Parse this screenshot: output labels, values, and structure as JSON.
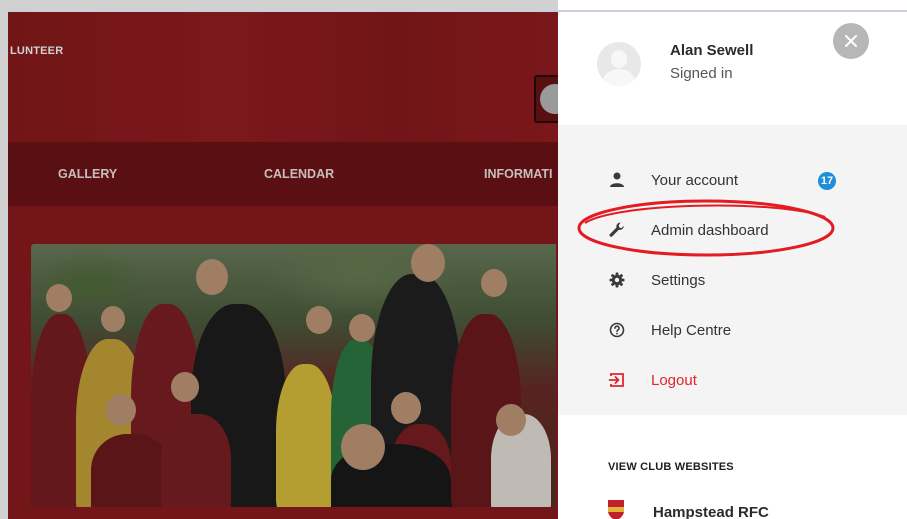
{
  "background_site": {
    "title": "LUNTEER",
    "nav": [
      {
        "label": "GALLERY"
      },
      {
        "label": "CALENDAR"
      },
      {
        "label": "INFORMATI"
      }
    ],
    "brand_color": "#8e1b1f"
  },
  "panel": {
    "user": {
      "name": "Alan Sewell",
      "status": "Signed in",
      "avatar_icon": "user-placeholder-icon"
    },
    "close_icon": "close-icon",
    "menu": [
      {
        "label": "Your account",
        "icon": "person-icon",
        "badge": "17"
      },
      {
        "label": "Admin dashboard",
        "icon": "wrench-icon"
      },
      {
        "label": "Settings",
        "icon": "gear-icon"
      },
      {
        "label": "Help Centre",
        "icon": "help-icon"
      },
      {
        "label": "Logout",
        "icon": "logout-icon"
      }
    ],
    "annotation_color": "#e31b23",
    "badge_color": "#1c8fd6",
    "logout_color": "#e0262d",
    "clubs": {
      "heading": "VIEW CLUB WEBSITES",
      "items": [
        {
          "label": "Hampstead RFC",
          "icon": "club-crest-icon"
        }
      ]
    }
  }
}
